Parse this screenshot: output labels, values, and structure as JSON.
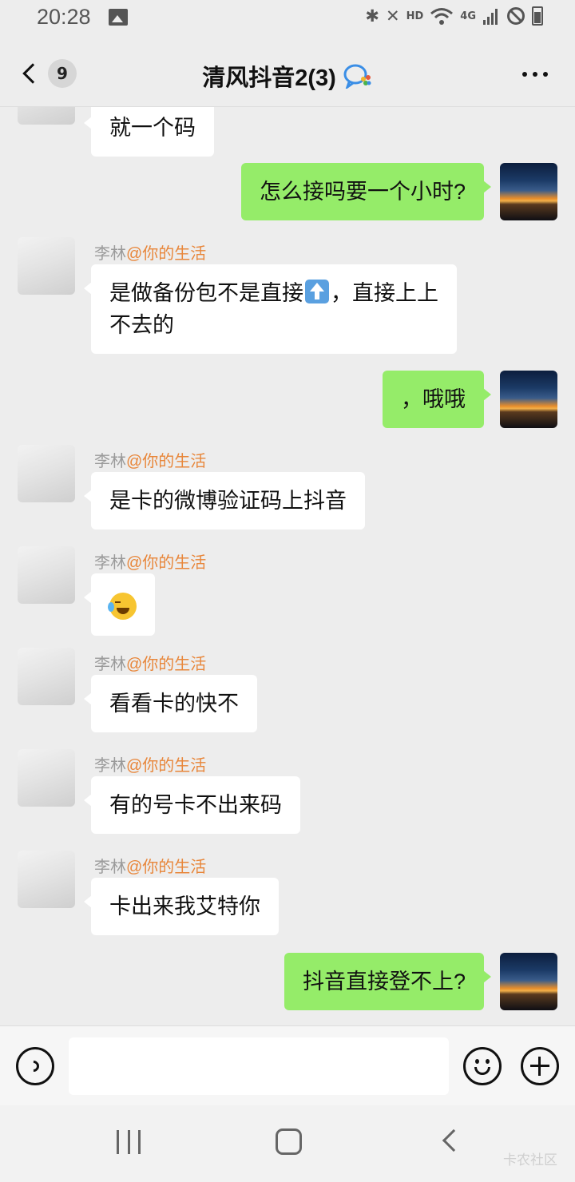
{
  "status_bar": {
    "time": "20:28",
    "hd": "HD",
    "net": "4G",
    "icons": [
      "image-icon",
      "bluetooth-icon",
      "mute-icon",
      "wifi-icon",
      "signal-icon",
      "block-icon",
      "battery-icon"
    ]
  },
  "header": {
    "unread_count": "9",
    "title": "清风抖音2(3)"
  },
  "messages": [
    {
      "side": "other",
      "text": "就一个码"
    },
    {
      "side": "me",
      "text": "怎么接吗要一个小时?"
    },
    {
      "side": "other",
      "name": "李林",
      "mention": "@你的生活",
      "text_before": "是做备份包不是直接",
      "emoji": "up-arrow-emoji",
      "text_after": "，直接上上",
      "text_line2": "不去的"
    },
    {
      "side": "me",
      "text": "，哦哦"
    },
    {
      "side": "other",
      "name": "李林",
      "mention": "@你的生活",
      "text": "是卡的微博验证码上抖音"
    },
    {
      "side": "other",
      "name": "李林",
      "mention": "@你的生活",
      "emoji": "facepalm-laugh-emoji"
    },
    {
      "side": "other",
      "name": "李林",
      "mention": "@你的生活",
      "text": "看看卡的快不"
    },
    {
      "side": "other",
      "name": "李林",
      "mention": "@你的生活",
      "text": "有的号卡不出来码"
    },
    {
      "side": "other",
      "name": "李林",
      "mention": "@你的生活",
      "text": "卡出来我艾特你"
    },
    {
      "side": "me",
      "text": "抖音直接登不上?"
    }
  ],
  "input": {
    "value": ""
  },
  "watermark": "卡农社区",
  "colors": {
    "my_bubble": "#95ec69",
    "other_bubble": "#ffffff",
    "background": "#ededed",
    "mention": "#e8863a"
  }
}
